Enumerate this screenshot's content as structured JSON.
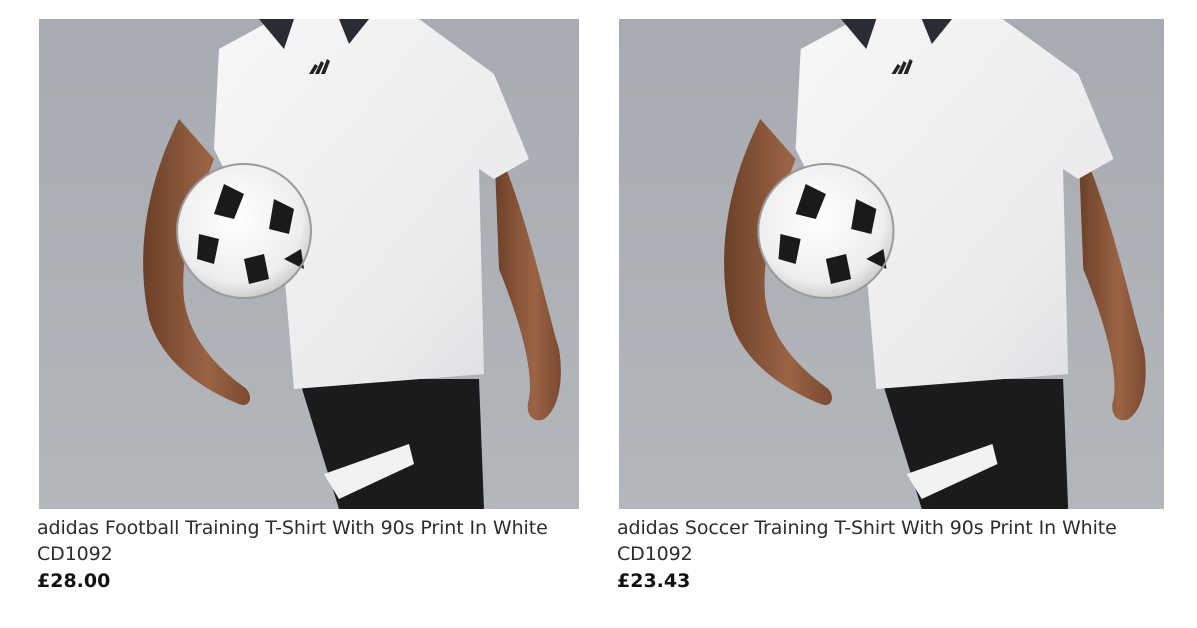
{
  "products": [
    {
      "title": "adidas Football Training T-Shirt With 90s Print In White CD1092",
      "price": "£28.00",
      "image": "product-photo"
    },
    {
      "title": "adidas Soccer Training T-Shirt With 90s Print In White CD1092",
      "price": "£23.43",
      "image": "product-photo"
    }
  ],
  "colors": {
    "background": "#ffffff",
    "photo_backdrop": "#a9acb2",
    "text": "#2d2d2d",
    "price": "#111111"
  }
}
